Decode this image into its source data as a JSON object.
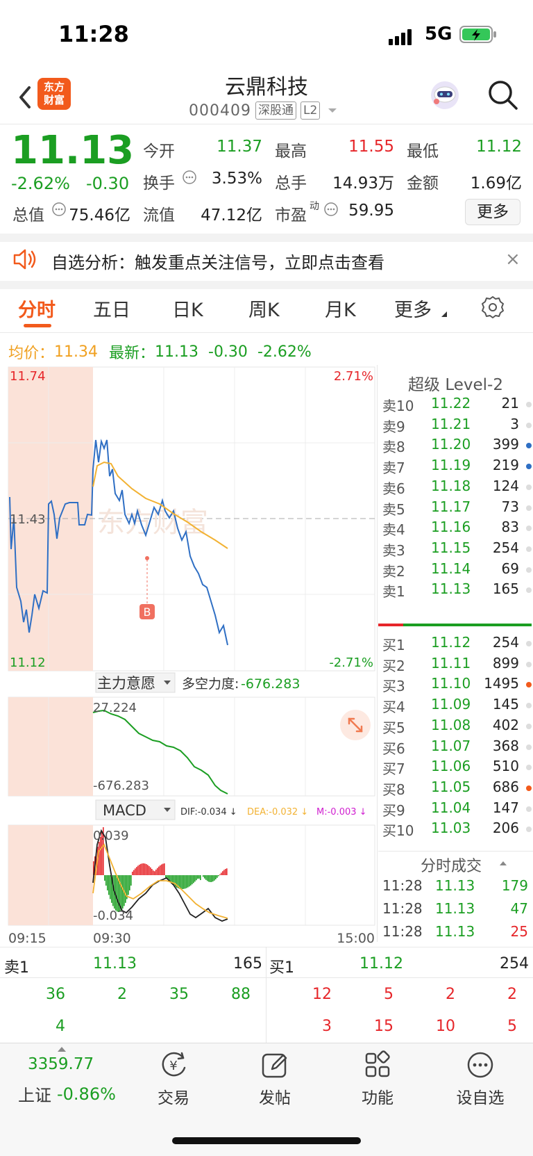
{
  "status_bar": {
    "time": "11:28",
    "network": "5G"
  },
  "header": {
    "logo_line1": "东方",
    "logo_line2": "财富",
    "name": "云鼎科技",
    "code": "000409",
    "tag1": "深股通",
    "tag2": "L2"
  },
  "quote": {
    "price": "11.13",
    "change_pct": "-2.62%",
    "change_val": "-0.30",
    "open_label": "今开",
    "open": "11.37",
    "high_label": "最高",
    "high": "11.55",
    "low_label": "最低",
    "low": "11.12",
    "turnover_label": "换手",
    "turnover": "3.53%",
    "volume_label": "总手",
    "volume": "14.93万",
    "amount_label": "金额",
    "amount": "1.69亿",
    "mktcap_label": "总值",
    "mktcap": "75.46亿",
    "float_label": "流值",
    "float": "47.12亿",
    "pe_label": "市盈",
    "pe_sup": "动",
    "pe": "59.95",
    "more": "更多"
  },
  "notice": {
    "text": "自选分析：触发重点关注信号，立即点击查看",
    "close": "×"
  },
  "tabs": [
    "分时",
    "五日",
    "日K",
    "周K",
    "月K",
    "更多"
  ],
  "info_line": {
    "avg_label": "均价：",
    "avg": "11.34",
    "latest_label": "最新：",
    "latest": "11.13",
    "latest_chg": "-0.30",
    "latest_pct": "-2.62%"
  },
  "chart": {
    "y_top": "11.74",
    "y_mid": "11.43",
    "y_bottom": "11.12",
    "pct_top": "2.71%",
    "pct_bottom": "-2.71%",
    "marker": "B",
    "x_start": "09:15",
    "x_mid": "09:30",
    "x_end": "15:00",
    "indicator_name": "主力意愿",
    "indicator_value_label": "多空力度:",
    "indicator_value": "-676.283",
    "indicator_top": "27.224",
    "indicator_bottom": "-676.283",
    "macd_name": "MACD",
    "dif": "DIF:-0.034 ↓",
    "dea": "DEA:-0.032 ↓",
    "m": "M:-0.003 ↓",
    "macd_top": "0.039",
    "macd_bottom": "-0.034",
    "colors": {
      "price": "#2f6fc4",
      "avg": "#f2b233",
      "up": "#e6262a",
      "down": "#1b9e22"
    }
  },
  "order_book": {
    "title": "超级 Level-2",
    "asks": [
      {
        "label": "卖10",
        "price": "11.22",
        "vol": "21"
      },
      {
        "label": "卖9",
        "price": "11.21",
        "vol": "3"
      },
      {
        "label": "卖8",
        "price": "11.20",
        "vol": "399"
      },
      {
        "label": "卖7",
        "price": "11.19",
        "vol": "219"
      },
      {
        "label": "卖6",
        "price": "11.18",
        "vol": "124"
      },
      {
        "label": "卖5",
        "price": "11.17",
        "vol": "73"
      },
      {
        "label": "卖4",
        "price": "11.16",
        "vol": "83"
      },
      {
        "label": "卖3",
        "price": "11.15",
        "vol": "254"
      },
      {
        "label": "卖2",
        "price": "11.14",
        "vol": "69"
      },
      {
        "label": "卖1",
        "price": "11.13",
        "vol": "165"
      }
    ],
    "bids": [
      {
        "label": "买1",
        "price": "11.12",
        "vol": "254"
      },
      {
        "label": "买2",
        "price": "11.11",
        "vol": "899"
      },
      {
        "label": "买3",
        "price": "11.10",
        "vol": "1495"
      },
      {
        "label": "买4",
        "price": "11.09",
        "vol": "145"
      },
      {
        "label": "买5",
        "price": "11.08",
        "vol": "402"
      },
      {
        "label": "买6",
        "price": "11.07",
        "vol": "368"
      },
      {
        "label": "买7",
        "price": "11.06",
        "vol": "510"
      },
      {
        "label": "买8",
        "price": "11.05",
        "vol": "686"
      },
      {
        "label": "买9",
        "price": "11.04",
        "vol": "147"
      },
      {
        "label": "买10",
        "price": "11.03",
        "vol": "206"
      }
    ],
    "trades_title": "分时成交",
    "trades": [
      {
        "time": "11:28",
        "price": "11.13",
        "vol": "179"
      },
      {
        "time": "11:28",
        "price": "11.13",
        "vol": "47"
      },
      {
        "time": "11:28",
        "price": "11.13",
        "vol": "25"
      }
    ]
  },
  "queue": {
    "sell_label": "卖1",
    "sell_price": "11.13",
    "sell_vol": "165",
    "buy_label": "买1",
    "buy_price": "11.12",
    "buy_vol": "254",
    "sell_row1": [
      "36",
      "2",
      "35",
      "88"
    ],
    "sell_row2": [
      "4"
    ],
    "buy_row1": [
      "12",
      "5",
      "2",
      "2"
    ],
    "buy_row2": [
      "3",
      "15",
      "10",
      "5"
    ]
  },
  "bottom_nav": {
    "index_value": "3359.77",
    "index_name": "上证",
    "index_pct": "-0.86%",
    "items": [
      "交易",
      "发帖",
      "功能",
      "设自选"
    ]
  }
}
